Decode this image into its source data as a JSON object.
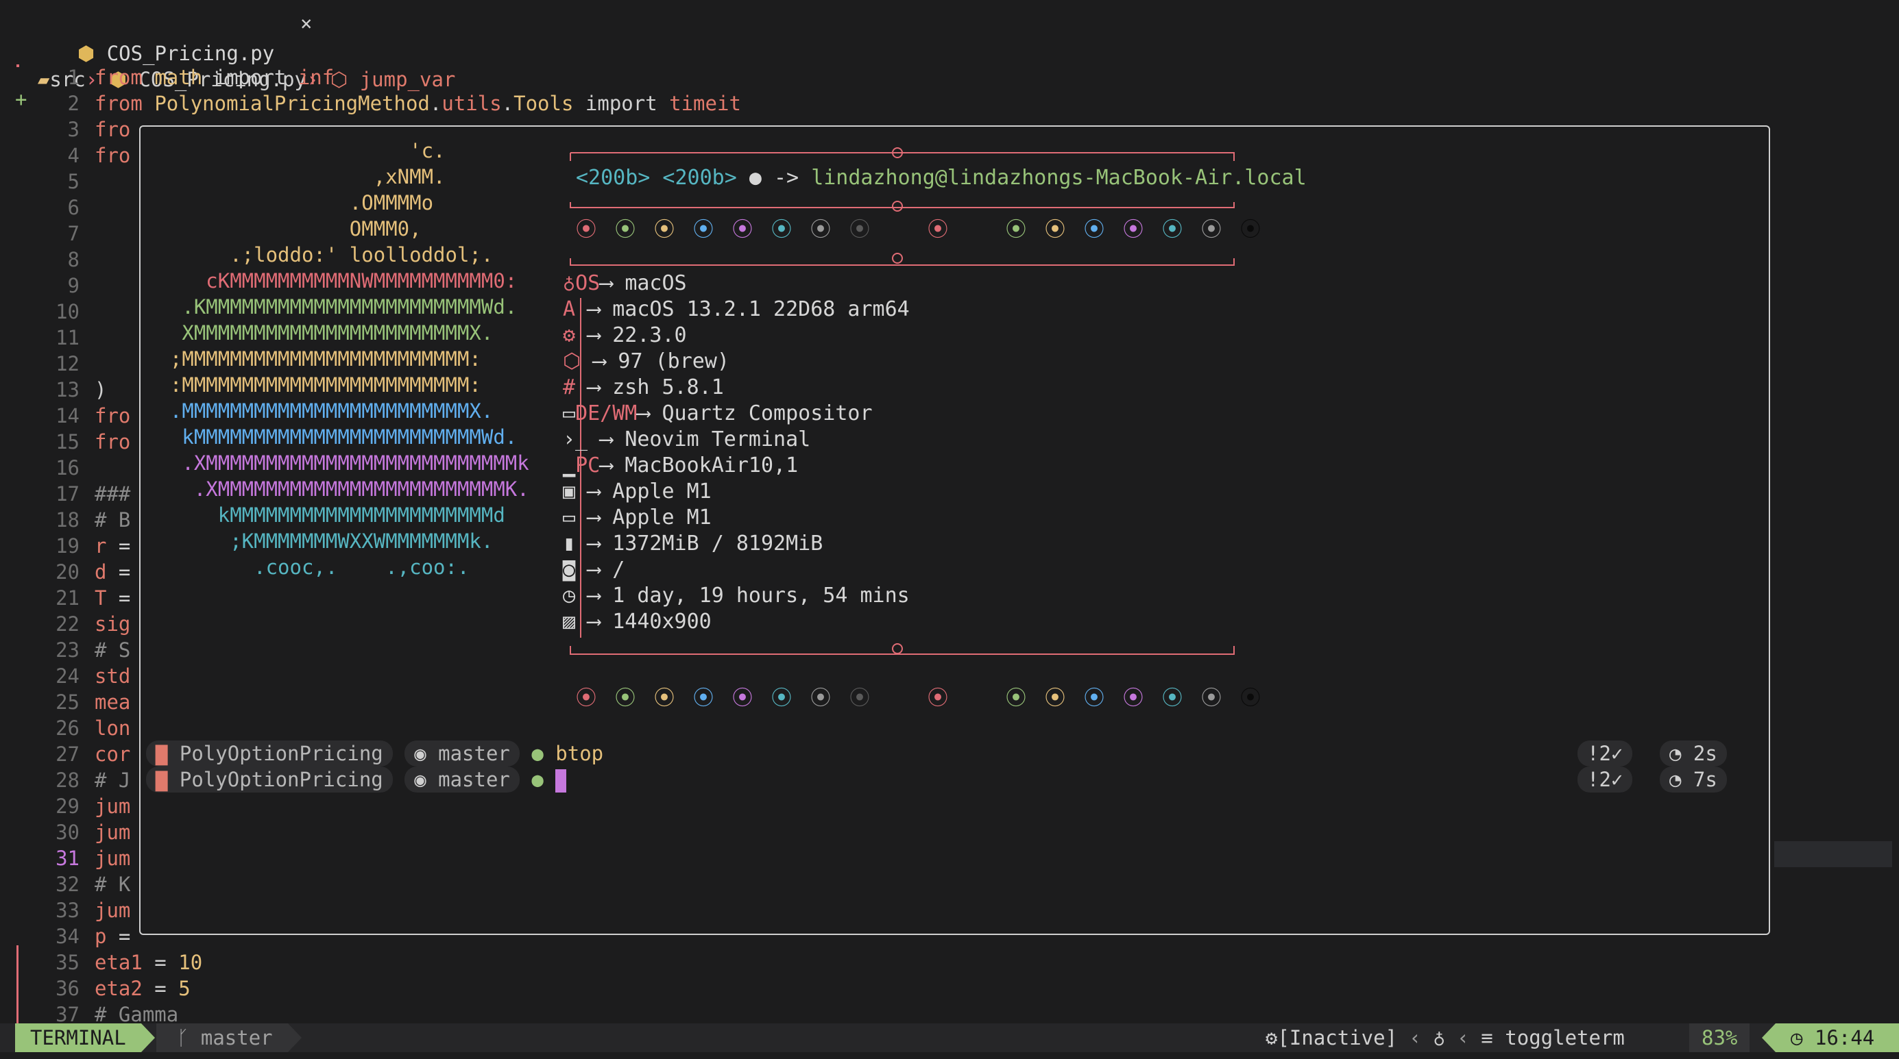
{
  "tab": {
    "filename": "COS_Pricing.py",
    "close": "×"
  },
  "breadcrumb": {
    "folder": "src",
    "file": "COS_Pricing.py",
    "symbol": "jump_var",
    "sep": "›"
  },
  "editor": {
    "lines": [
      {
        "n": "1",
        "parts": [
          [
            "kw",
            "from "
          ],
          [
            "mod",
            "math"
          ],
          [
            "plain",
            " import "
          ],
          [
            "kw",
            "inf"
          ]
        ]
      },
      {
        "n": "2",
        "parts": [
          [
            "kw",
            "from "
          ],
          [
            "mod",
            "PolynomialPricingMethod"
          ],
          [
            "plain",
            "."
          ],
          [
            "kw",
            "utils"
          ],
          [
            "plain",
            "."
          ],
          [
            "mod",
            "Tools"
          ],
          [
            "plain",
            " import "
          ],
          [
            "kw",
            "timeit"
          ]
        ]
      },
      {
        "n": "3",
        "parts": [
          [
            "kw",
            "fro"
          ]
        ]
      },
      {
        "n": "4",
        "parts": [
          [
            "kw",
            "fro"
          ]
        ]
      },
      {
        "n": "5",
        "parts": []
      },
      {
        "n": "6",
        "parts": []
      },
      {
        "n": "7",
        "parts": []
      },
      {
        "n": "8",
        "parts": []
      },
      {
        "n": "9",
        "parts": []
      },
      {
        "n": "10",
        "parts": []
      },
      {
        "n": "11",
        "parts": []
      },
      {
        "n": "12",
        "parts": []
      },
      {
        "n": "13",
        "parts": [
          [
            "plain",
            ")"
          ]
        ]
      },
      {
        "n": "14",
        "parts": [
          [
            "kw",
            "fro"
          ]
        ]
      },
      {
        "n": "15",
        "parts": [
          [
            "kw",
            "fro"
          ]
        ]
      },
      {
        "n": "16",
        "parts": []
      },
      {
        "n": "17",
        "parts": [
          [
            "cmt",
            "###"
          ]
        ]
      },
      {
        "n": "18",
        "parts": [
          [
            "cmt",
            "# B"
          ]
        ]
      },
      {
        "n": "19",
        "parts": [
          [
            "kw",
            "r "
          ],
          [
            "plain",
            "="
          ]
        ]
      },
      {
        "n": "20",
        "parts": [
          [
            "kw",
            "d "
          ],
          [
            "plain",
            "="
          ]
        ]
      },
      {
        "n": "21",
        "parts": [
          [
            "kw",
            "T "
          ],
          [
            "plain",
            "="
          ]
        ]
      },
      {
        "n": "22",
        "parts": [
          [
            "kw",
            "sig"
          ]
        ]
      },
      {
        "n": "23",
        "parts": [
          [
            "cmt",
            "# S"
          ]
        ]
      },
      {
        "n": "24",
        "parts": [
          [
            "kw",
            "std"
          ]
        ]
      },
      {
        "n": "25",
        "parts": [
          [
            "kw",
            "mea"
          ]
        ]
      },
      {
        "n": "26",
        "parts": [
          [
            "kw",
            "lon"
          ]
        ]
      },
      {
        "n": "27",
        "parts": [
          [
            "kw",
            "cor"
          ]
        ]
      },
      {
        "n": "28",
        "parts": [
          [
            "cmt",
            "# J"
          ]
        ]
      },
      {
        "n": "29",
        "parts": [
          [
            "kw",
            "jum"
          ]
        ]
      },
      {
        "n": "30",
        "parts": [
          [
            "kw",
            "jum"
          ]
        ]
      },
      {
        "n": "31",
        "parts": [
          [
            "kw",
            "jum"
          ]
        ]
      },
      {
        "n": "32",
        "parts": [
          [
            "cmt",
            "# K"
          ]
        ]
      },
      {
        "n": "33",
        "parts": [
          [
            "kw",
            "jum"
          ]
        ]
      },
      {
        "n": "34",
        "parts": [
          [
            "kw",
            "p "
          ],
          [
            "plain",
            "="
          ]
        ]
      },
      {
        "n": "35",
        "parts": [
          [
            "kw",
            "eta1"
          ],
          [
            "plain",
            " = "
          ],
          [
            "num",
            "10"
          ]
        ]
      },
      {
        "n": "36",
        "parts": [
          [
            "kw",
            "eta2"
          ],
          [
            "plain",
            " = "
          ],
          [
            "num",
            "5"
          ]
        ]
      },
      {
        "n": "37",
        "parts": [
          [
            "cmt",
            "# Gamma"
          ]
        ]
      }
    ]
  },
  "neofetch": {
    "art": [
      [
        "yellow",
        "                      'c."
      ],
      [
        "yellow",
        "                   ,xNMM."
      ],
      [
        "yellow",
        "                 .OMMMMo"
      ],
      [
        "yellow",
        "                 OMMM0,"
      ],
      [
        "yellow",
        "       .;loddo:' loolloddol;."
      ],
      [
        "pink",
        "     cKMMMMMMMMMMNWMMMMMMMMMM0:"
      ],
      [
        "green",
        "   .KMMMMMMMMMMMMMMMMMMMMMMMWd."
      ],
      [
        "green",
        "   XMMMMMMMMMMMMMMMMMMMMMMMX."
      ],
      [
        "yellow",
        "  ;MMMMMMMMMMMMMMMMMMMMMMMM:"
      ],
      [
        "yellow",
        "  :MMMMMMMMMMMMMMMMMMMMMMMM:"
      ],
      [
        "blue",
        "  .MMMMMMMMMMMMMMMMMMMMMMMMX."
      ],
      [
        "blue",
        "   kMMMMMMMMMMMMMMMMMMMMMMMMWd."
      ],
      [
        "purple",
        "   .XMMMMMMMMMMMMMMMMMMMMMMMMMMk"
      ],
      [
        "purple",
        "    .XMMMMMMMMMMMMMMMMMMMMMMMMK."
      ],
      [
        "cyan",
        "      kMMMMMMMMMMMMMMMMMMMMMMd"
      ],
      [
        "cyan",
        "       ;KMMMMMMMWXXWMMMMMMMk."
      ],
      [
        "cyan",
        "         .cooc,.    .,coo:."
      ]
    ],
    "header": {
      "keys": "<200b> <200b>",
      "arrow": "->",
      "user": "lindazhong@lindazhongs-MacBook-Air.local"
    },
    "os": {
      "label": "OS",
      "value": "macOS",
      "items": [
        {
          "icon": "apple-logo-icon",
          "value": "macOS 13.2.1 22D68 arm64"
        },
        {
          "icon": "gear-icon",
          "value": "22.3.0"
        },
        {
          "icon": "package-icon",
          "value": "97 (brew)"
        },
        {
          "icon": "hash-icon",
          "value": "zsh 5.8.1"
        }
      ]
    },
    "de": {
      "label": "DE/WM",
      "value": "Quartz Compositor",
      "items": [
        {
          "icon": "terminal-icon",
          "value": "Neovim Terminal"
        }
      ]
    },
    "pc": {
      "label": "PC",
      "value": "MacBookAir10,1",
      "items": [
        {
          "icon": "cpu-icon",
          "value": "Apple M1"
        },
        {
          "icon": "monitor-icon",
          "value": "Apple M1"
        },
        {
          "icon": "memory-icon",
          "value": "1372MiB / 8192MiB"
        },
        {
          "icon": "disk-icon",
          "value": "/"
        },
        {
          "icon": "clock-icon",
          "value": "1 day, 19 hours, 54 mins"
        },
        {
          "icon": "image-icon",
          "value": "1440x900"
        }
      ]
    },
    "arrow": "⟶",
    "palette": [
      "#e06c75",
      "#98c379",
      "#e5c07b",
      "#61afef",
      "#c678dd",
      "#56b6c2",
      "#9a9a9a",
      "#5a5a5a",
      "#e06c75",
      "#98c379",
      "#e5c07b",
      "#61afef",
      "#c678dd",
      "#56b6c2",
      "#9a9a9a",
      "#0a0a0a"
    ]
  },
  "prompts": [
    {
      "dir": "PolyOptionPricing",
      "branch": "master",
      "cmd": "btop",
      "git_status": "!2✓",
      "duration": "2s"
    },
    {
      "dir": "PolyOptionPricing",
      "branch": "master",
      "cmd": "",
      "git_status": "!2✓",
      "duration": "7s"
    }
  ],
  "statusline": {
    "mode": "TERMINAL",
    "branch": "master",
    "lsp": "[Inactive]",
    "filetype": "toggleterm",
    "progress": "83%",
    "time": "16:44",
    "accent": "#98c379"
  }
}
